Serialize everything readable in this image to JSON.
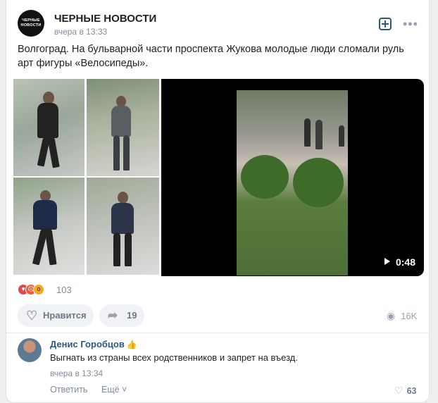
{
  "post": {
    "group_name": "ЧЕРНЫЕ НОВОСТИ",
    "avatar_text": [
      "ЧЕРНЫЕ",
      "НОВОСТИ"
    ],
    "time": "вчера в 13:33",
    "text": "Волгоград. На бульварной части проспекта Жукова молодые люди сломали руль арт фигуры «Велосипеды».",
    "video_duration": "0:48",
    "reaction_count": "103",
    "like_label": "Нравится",
    "share_count": "19",
    "views": "16K"
  },
  "comment": {
    "author": "Денис Горобцов",
    "text": "Выгнать из страны всех родственников и запрет на въезд.",
    "time": "вчера в 13:34",
    "reply_label": "Ответить",
    "more_label": "Ещё",
    "likes": "63"
  },
  "icons": {
    "add": "add-square-icon",
    "more": "more-horizontal-icon",
    "heart": "heart-icon",
    "share": "share-arrow-icon",
    "eye": "eye-icon",
    "play": "play-icon",
    "badge": "thumbs-up-icon"
  },
  "colors": {
    "link": "#2a5885",
    "muted": "#818c99",
    "button_bg": "#f0f2f5"
  }
}
